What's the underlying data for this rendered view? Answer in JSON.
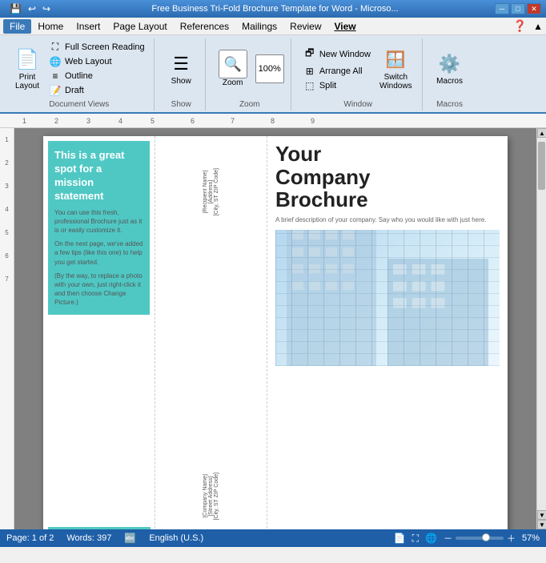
{
  "titlebar": {
    "title": "Free Business Tri-Fold Brochure Template for Word - Microsо...",
    "min_btn": "─",
    "max_btn": "□",
    "close_btn": "✕"
  },
  "quickaccess": {
    "save_icon": "💾",
    "undo_icon": "↩",
    "redo_icon": "↪"
  },
  "tabs": {
    "file": "File",
    "home": "Home",
    "insert": "Insert",
    "page_layout": "Page Layout",
    "references": "References",
    "mailings": "Mailings",
    "review": "Review",
    "view": "View"
  },
  "ribbon": {
    "active_tab": "View",
    "groups": {
      "document_views": {
        "label": "Document Views",
        "print_layout": "Print\nLayout",
        "full_screen": "Full Screen\nReading",
        "web_layout": "Web Layout",
        "outline": "Outline",
        "draft": "Draft"
      },
      "show": {
        "label": "Show",
        "btn": "Show"
      },
      "zoom": {
        "label": "Zoom",
        "btn": "Zoom",
        "percent": "100%"
      },
      "window": {
        "label": "Window",
        "new_window": "New Window",
        "arrange_all": "Arrange All",
        "split": "Split",
        "switch_windows": "Switch\nWindows"
      },
      "macros": {
        "label": "Macros",
        "btn": "Macros"
      }
    }
  },
  "document": {
    "left_panel": {
      "heading": "This is a great spot for a mission statement",
      "body1": "You can use this fresh, professional Brochure just as it is or easily customize it.",
      "body2": "On the next page, we've added a few tips (like this one) to help you get started.",
      "body3": "(By the way, to replace a photo with your own, just right-click it and then choose Change Picture.)"
    },
    "mid_panel": {
      "address1_line1": "[Recipient Name]",
      "address1_line2": "[Address]",
      "address1_line3": "[City, ST ZIP Code]",
      "address2_line1": "[Company Name]",
      "address2_line2": "[Street Address]",
      "address2_line3": "[City, ST ZIP Code]"
    },
    "right_panel": {
      "company": "Your\nCompany\nBrochure",
      "subtitle": "A brief description of your company. Say who you would like with just here."
    }
  },
  "statusbar": {
    "page": "Page: 1 of 2",
    "words": "Words: 397",
    "language": "English (U.S.)",
    "zoom_pct": "57%"
  }
}
